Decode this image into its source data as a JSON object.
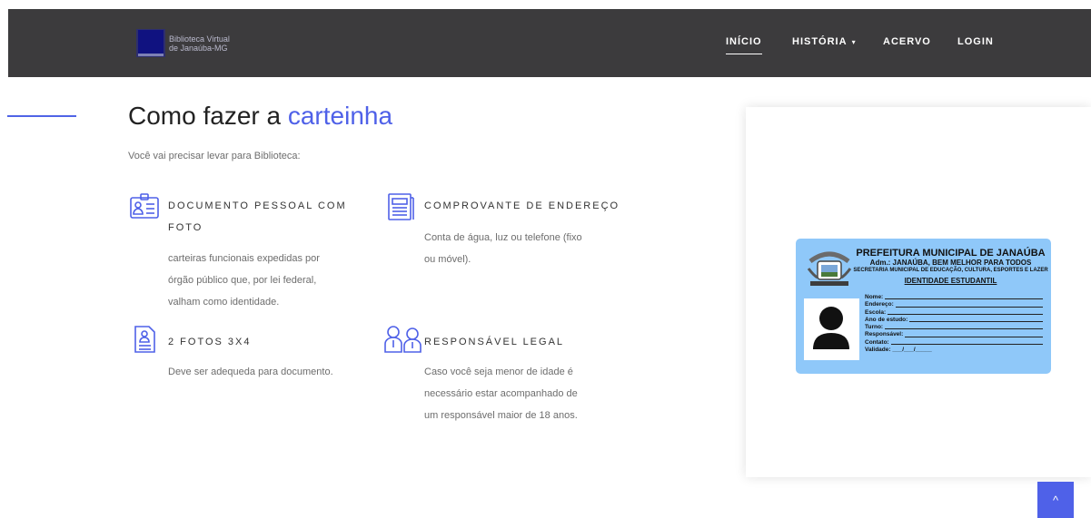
{
  "brand": {
    "line1": "Biblioteca Virtual",
    "line2": "de Janaúba-MG"
  },
  "nav": {
    "items": [
      {
        "label": "INÍCIO",
        "active": true
      },
      {
        "label": "HISTÓRIA",
        "dropdown_icon": "caret-down-icon"
      },
      {
        "label": "ACERVO"
      },
      {
        "label": "LOGIN"
      }
    ],
    "caret": "▾"
  },
  "main": {
    "title_part1": "Como fazer a ",
    "title_part2": "carteinha",
    "intro": "Você vai precisar levar para Biblioteca:",
    "features": [
      {
        "icon": "id-card-icon",
        "title_line1": "DOCUMENTO PESSOAL COM",
        "title_line2": "FOTO",
        "text_lines": [
          "carteiras funcionais expedidas por",
          "órgão público que, por lei federal,",
          "valham como identidade."
        ]
      },
      {
        "icon": "document-newspaper-icon",
        "title_line1": "COMPROVANTE DE ENDEREÇO",
        "text_lines": [
          "Conta de água, luz ou telefone (fixo",
          "ou móvel)."
        ]
      },
      {
        "icon": "photo-document-icon",
        "title_line1": "2 FOTOS 3X4",
        "text_lines": [
          "Deve ser adequeda para documento."
        ]
      },
      {
        "icon": "people-icon",
        "title_line1": "RESPONSÁVEL LEGAL",
        "text_lines": [
          "Caso você seja menor de idade é",
          "necessário estar acompanhado de",
          "um responsável maior de 18 anos."
        ]
      }
    ]
  },
  "card": {
    "title": "PREFEITURA MUNICIPAL DE JANAÚBA",
    "subtitle": "Adm.: JANAÚBA, BEM MELHOR PARA TODOS",
    "secretaria": "SECRETARIA MUNICIPAL DE EDUCAÇÃO, CULTURA, ESPORTES E LAZER",
    "heading": "IDENTIDADE ESTUDANTIL",
    "fields": [
      "Nome:",
      "Endereço:",
      "Escola:",
      "Ano de estudo:",
      "Turno:",
      "Responsável:",
      "Contato:"
    ],
    "validade": "Validade: ___/___/_____"
  },
  "back_to_top": {
    "icon": "chevron-up-icon",
    "glyph": "^"
  },
  "colors": {
    "navbar": "#3c3b3d",
    "accent": "#4f61e8",
    "card": "#8fc8f9"
  }
}
